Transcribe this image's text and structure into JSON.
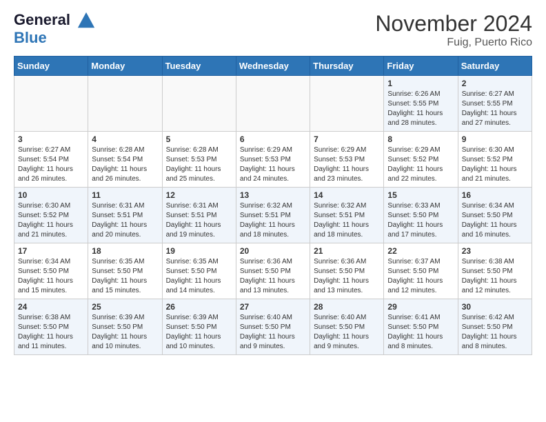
{
  "header": {
    "logo_line1": "General",
    "logo_line2": "Blue",
    "month": "November 2024",
    "location": "Fuig, Puerto Rico"
  },
  "days_of_week": [
    "Sunday",
    "Monday",
    "Tuesday",
    "Wednesday",
    "Thursday",
    "Friday",
    "Saturday"
  ],
  "weeks": [
    [
      {
        "day": "",
        "info": ""
      },
      {
        "day": "",
        "info": ""
      },
      {
        "day": "",
        "info": ""
      },
      {
        "day": "",
        "info": ""
      },
      {
        "day": "",
        "info": ""
      },
      {
        "day": "1",
        "info": "Sunrise: 6:26 AM\nSunset: 5:55 PM\nDaylight: 11 hours\nand 28 minutes."
      },
      {
        "day": "2",
        "info": "Sunrise: 6:27 AM\nSunset: 5:55 PM\nDaylight: 11 hours\nand 27 minutes."
      }
    ],
    [
      {
        "day": "3",
        "info": "Sunrise: 6:27 AM\nSunset: 5:54 PM\nDaylight: 11 hours\nand 26 minutes."
      },
      {
        "day": "4",
        "info": "Sunrise: 6:28 AM\nSunset: 5:54 PM\nDaylight: 11 hours\nand 26 minutes."
      },
      {
        "day": "5",
        "info": "Sunrise: 6:28 AM\nSunset: 5:53 PM\nDaylight: 11 hours\nand 25 minutes."
      },
      {
        "day": "6",
        "info": "Sunrise: 6:29 AM\nSunset: 5:53 PM\nDaylight: 11 hours\nand 24 minutes."
      },
      {
        "day": "7",
        "info": "Sunrise: 6:29 AM\nSunset: 5:53 PM\nDaylight: 11 hours\nand 23 minutes."
      },
      {
        "day": "8",
        "info": "Sunrise: 6:29 AM\nSunset: 5:52 PM\nDaylight: 11 hours\nand 22 minutes."
      },
      {
        "day": "9",
        "info": "Sunrise: 6:30 AM\nSunset: 5:52 PM\nDaylight: 11 hours\nand 21 minutes."
      }
    ],
    [
      {
        "day": "10",
        "info": "Sunrise: 6:30 AM\nSunset: 5:52 PM\nDaylight: 11 hours\nand 21 minutes."
      },
      {
        "day": "11",
        "info": "Sunrise: 6:31 AM\nSunset: 5:51 PM\nDaylight: 11 hours\nand 20 minutes."
      },
      {
        "day": "12",
        "info": "Sunrise: 6:31 AM\nSunset: 5:51 PM\nDaylight: 11 hours\nand 19 minutes."
      },
      {
        "day": "13",
        "info": "Sunrise: 6:32 AM\nSunset: 5:51 PM\nDaylight: 11 hours\nand 18 minutes."
      },
      {
        "day": "14",
        "info": "Sunrise: 6:32 AM\nSunset: 5:51 PM\nDaylight: 11 hours\nand 18 minutes."
      },
      {
        "day": "15",
        "info": "Sunrise: 6:33 AM\nSunset: 5:50 PM\nDaylight: 11 hours\nand 17 minutes."
      },
      {
        "day": "16",
        "info": "Sunrise: 6:34 AM\nSunset: 5:50 PM\nDaylight: 11 hours\nand 16 minutes."
      }
    ],
    [
      {
        "day": "17",
        "info": "Sunrise: 6:34 AM\nSunset: 5:50 PM\nDaylight: 11 hours\nand 15 minutes."
      },
      {
        "day": "18",
        "info": "Sunrise: 6:35 AM\nSunset: 5:50 PM\nDaylight: 11 hours\nand 15 minutes."
      },
      {
        "day": "19",
        "info": "Sunrise: 6:35 AM\nSunset: 5:50 PM\nDaylight: 11 hours\nand 14 minutes."
      },
      {
        "day": "20",
        "info": "Sunrise: 6:36 AM\nSunset: 5:50 PM\nDaylight: 11 hours\nand 13 minutes."
      },
      {
        "day": "21",
        "info": "Sunrise: 6:36 AM\nSunset: 5:50 PM\nDaylight: 11 hours\nand 13 minutes."
      },
      {
        "day": "22",
        "info": "Sunrise: 6:37 AM\nSunset: 5:50 PM\nDaylight: 11 hours\nand 12 minutes."
      },
      {
        "day": "23",
        "info": "Sunrise: 6:38 AM\nSunset: 5:50 PM\nDaylight: 11 hours\nand 12 minutes."
      }
    ],
    [
      {
        "day": "24",
        "info": "Sunrise: 6:38 AM\nSunset: 5:50 PM\nDaylight: 11 hours\nand 11 minutes."
      },
      {
        "day": "25",
        "info": "Sunrise: 6:39 AM\nSunset: 5:50 PM\nDaylight: 11 hours\nand 10 minutes."
      },
      {
        "day": "26",
        "info": "Sunrise: 6:39 AM\nSunset: 5:50 PM\nDaylight: 11 hours\nand 10 minutes."
      },
      {
        "day": "27",
        "info": "Sunrise: 6:40 AM\nSunset: 5:50 PM\nDaylight: 11 hours\nand 9 minutes."
      },
      {
        "day": "28",
        "info": "Sunrise: 6:40 AM\nSunset: 5:50 PM\nDaylight: 11 hours\nand 9 minutes."
      },
      {
        "day": "29",
        "info": "Sunrise: 6:41 AM\nSunset: 5:50 PM\nDaylight: 11 hours\nand 8 minutes."
      },
      {
        "day": "30",
        "info": "Sunrise: 6:42 AM\nSunset: 5:50 PM\nDaylight: 11 hours\nand 8 minutes."
      }
    ]
  ]
}
